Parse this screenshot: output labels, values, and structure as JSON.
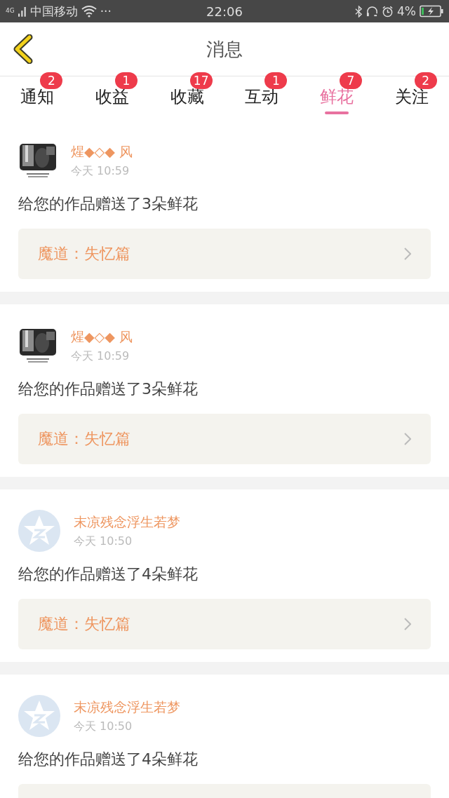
{
  "status_bar": {
    "network": "4G",
    "carrier": "中国移动",
    "more": "···",
    "time": "22:06",
    "battery": "4%"
  },
  "header": {
    "title": "消息"
  },
  "tabs": [
    {
      "label": "通知",
      "badge": "2",
      "selected": false
    },
    {
      "label": "收益",
      "badge": "1",
      "selected": false
    },
    {
      "label": "收藏",
      "badge": "17",
      "selected": false
    },
    {
      "label": "互动",
      "badge": "1",
      "selected": false
    },
    {
      "label": "鲜花",
      "badge": "7",
      "selected": true
    },
    {
      "label": "关注",
      "badge": "2",
      "selected": false
    }
  ],
  "messages": [
    {
      "kind": "picture",
      "name": "煋◆◇◆ 风",
      "time": "今天 10:59",
      "text": "给您的作品赠送了3朵鲜花",
      "work": "魔道：失忆篇"
    },
    {
      "kind": "picture",
      "name": "煋◆◇◆ 风",
      "time": "今天 10:59",
      "text": "给您的作品赠送了3朵鲜花",
      "work": "魔道：失忆篇"
    },
    {
      "kind": "default",
      "name": "末凉残念浮生若梦",
      "time": "今天 10:50",
      "text": "给您的作品赠送了4朵鲜花",
      "work": "魔道：失忆篇"
    },
    {
      "kind": "default",
      "name": "末凉残念浮生若梦",
      "time": "今天 10:50",
      "text": "给您的作品赠送了4朵鲜花"
    }
  ]
}
